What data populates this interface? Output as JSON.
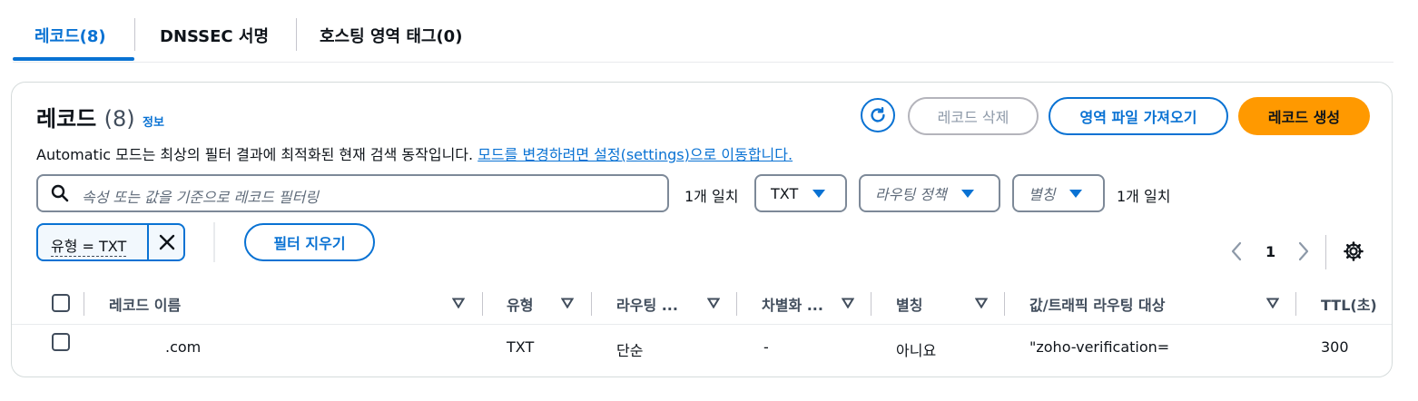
{
  "tabs": {
    "records": "레코드(8)",
    "dnssec": "DNSSEC 서명",
    "tags": "호스팅 영역 태그(0)"
  },
  "header": {
    "title": "레코드",
    "count": "(8)",
    "info": "정보",
    "description": "Automatic 모드는 최상의 필터 결과에 최적화된 현재 검색 동작입니다. ",
    "description_link": "모드를 변경하려면 설정(settings)으로 이동합니다."
  },
  "actions": {
    "delete": "레코드 삭제",
    "import": "영역 파일 가져오기",
    "create": "레코드 생성"
  },
  "filter": {
    "placeholder": "속성 또는 값을 기준으로 레코드 필터링",
    "match_left": "1개 일치",
    "type_select": "TXT",
    "routing_select": "라우팅 정책",
    "alias_select": "별칭",
    "match_right": "1개 일치",
    "token": "유형 = TXT",
    "clear": "필터 지우기"
  },
  "pagination": {
    "page": "1"
  },
  "table": {
    "columns": {
      "name": "레코드 이름",
      "type": "유형",
      "routing": "라우팅 ...",
      "differentiator": "차별화 ...",
      "alias": "별칭",
      "value": "값/트래픽 라우팅 대상",
      "ttl": "TTL(초)"
    },
    "rows": [
      {
        "name": ".com",
        "type": "TXT",
        "routing": "단순",
        "differentiator": "-",
        "alias": "아니요",
        "value": "\"zoho-verification=",
        "ttl": "300"
      }
    ]
  },
  "colors": {
    "accent": "#0972d3",
    "primary_button": "#ff9900",
    "border": "#7d8998"
  },
  "icons": [
    "refresh-icon",
    "search-icon",
    "caret-down-icon",
    "close-icon",
    "chevron-left-icon",
    "chevron-right-icon",
    "gear-icon",
    "sort-icon"
  ]
}
